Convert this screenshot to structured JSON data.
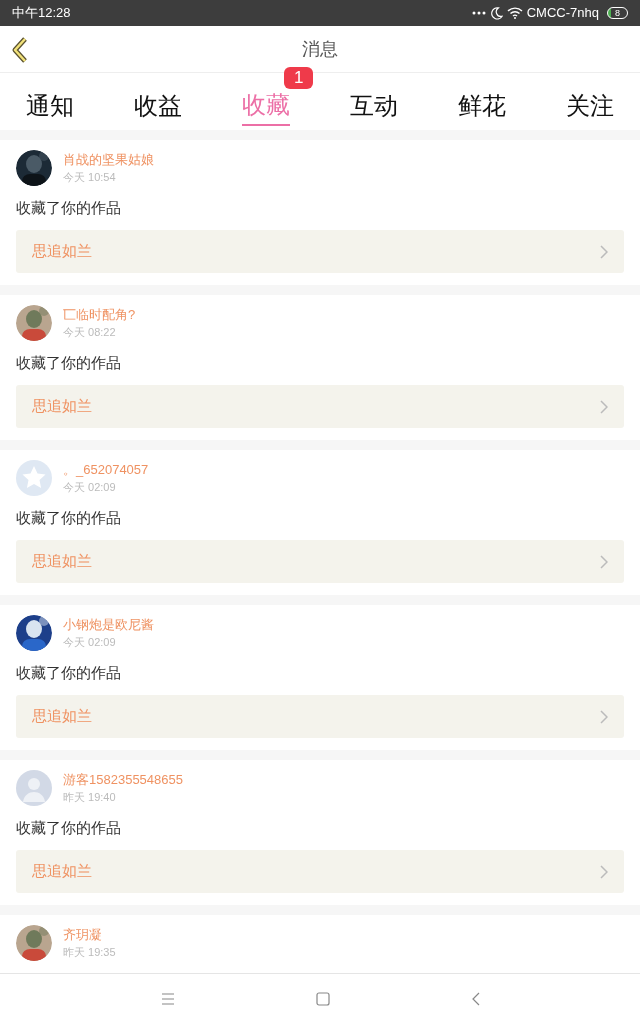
{
  "status_bar": {
    "time": "中午12:28",
    "network": "CMCC-7nhq",
    "battery": "8"
  },
  "header": {
    "title": "消息"
  },
  "tabs": [
    {
      "label": "通知",
      "selected": false
    },
    {
      "label": "收益",
      "selected": false
    },
    {
      "label": "收藏",
      "selected": true,
      "badge": "1"
    },
    {
      "label": "互动",
      "selected": false
    },
    {
      "label": "鲜花",
      "selected": false
    },
    {
      "label": "关注",
      "selected": false
    }
  ],
  "messages": [
    {
      "user": "肖战的坚果姑娘",
      "time": "今天 10:54",
      "text": "收藏了你的作品",
      "work": "思追如兰"
    },
    {
      "user": "匸临时配角?",
      "time": "今天 08:22",
      "text": "收藏了你的作品",
      "work": "思追如兰"
    },
    {
      "user": "。_652074057",
      "time": "今天 02:09",
      "avatar": {
        "kind": "default-star"
      },
      "text": "收藏了你的作品",
      "work": "思追如兰"
    },
    {
      "user": "小钢炮是欧尼酱",
      "time": "今天 02:09",
      "text": "收藏了你的作品",
      "work": "思追如兰"
    },
    {
      "user": "游客1582355548655",
      "time": "昨天 19:40",
      "avatar": {
        "kind": "default-person"
      },
      "text": "收藏了你的作品",
      "work": "思追如兰"
    },
    {
      "user": "齐玥凝",
      "time": "昨天 19:35"
    }
  ]
}
